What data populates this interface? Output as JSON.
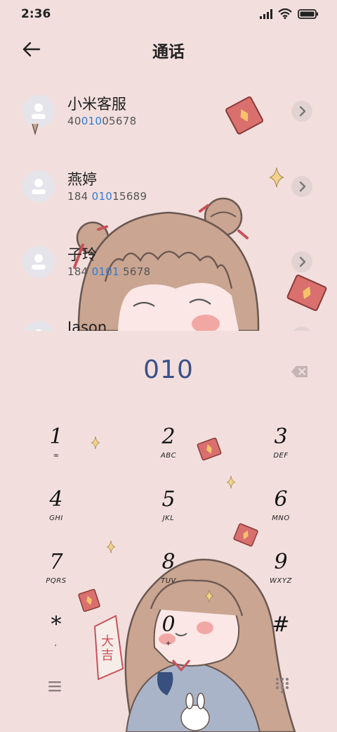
{
  "status": {
    "time": "2:36"
  },
  "header": {
    "title": "通话"
  },
  "contacts": [
    {
      "name": "小米客服",
      "num_pre": "40",
      "num_hl": "010",
      "num_post": "05678"
    },
    {
      "name": "燕婷",
      "num_pre": "184 ",
      "num_hl": "010",
      "num_post": "15689"
    },
    {
      "name": "子玲",
      "num_pre": "184 ",
      "num_hl": "0101",
      "num_post": " 5678"
    },
    {
      "name": "Jason",
      "num_pre": "",
      "num_hl": "",
      "num_post": ""
    }
  ],
  "dialer": {
    "input": "010",
    "keys": [
      {
        "digit": "1",
        "letters": "∞"
      },
      {
        "digit": "2",
        "letters": "ABC"
      },
      {
        "digit": "3",
        "letters": "DEF"
      },
      {
        "digit": "4",
        "letters": "GHI"
      },
      {
        "digit": "5",
        "letters": "JKL"
      },
      {
        "digit": "6",
        "letters": "MNO"
      },
      {
        "digit": "7",
        "letters": "PQRS"
      },
      {
        "digit": "8",
        "letters": "TUV"
      },
      {
        "digit": "9",
        "letters": "WXYZ"
      },
      {
        "digit": "*",
        "letters": ","
      },
      {
        "digit": "0",
        "letters": "+"
      },
      {
        "digit": "#",
        "letters": ""
      }
    ]
  },
  "wallpaper": {
    "charm_text": "大吉"
  },
  "colors": {
    "background": "#f2dfdd",
    "highlight": "#2f7bd6",
    "dial_text": "#3b5186",
    "envelope": "#d9706e"
  }
}
